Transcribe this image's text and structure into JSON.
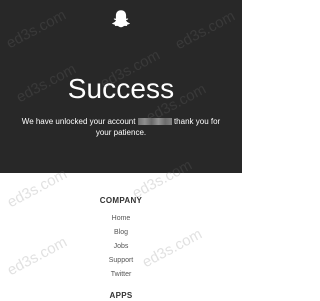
{
  "hero": {
    "background": "#282828",
    "logo_icon": "snapchat-ghost-icon",
    "title": "Success",
    "message_line1_start": "We have unlocked your account",
    "message_line1_end": "thank you for",
    "message_line2": "your patience."
  },
  "footer": {
    "company_title": "COMPANY",
    "links": [
      "Home",
      "Blog",
      "Jobs",
      "Support",
      "Twitter"
    ],
    "apps_title": "APPS"
  },
  "watermark": {
    "text": "ed3s.com"
  }
}
